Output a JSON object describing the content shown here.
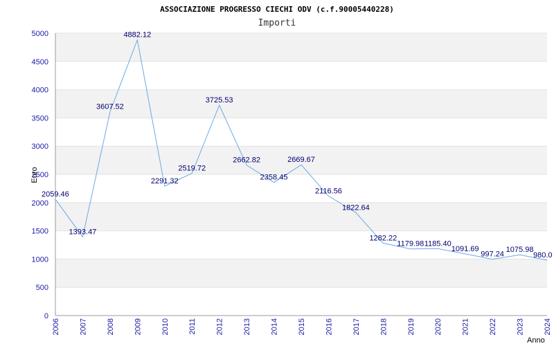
{
  "chart_data": {
    "type": "line",
    "title": "ASSOCIAZIONE PROGRESSO CIECHI ODV (c.f.90005440228)",
    "subtitle": "Importi",
    "xlabel": "Anno",
    "ylabel": "Euro",
    "x": [
      "2006",
      "2007",
      "2008",
      "2009",
      "2010",
      "2011",
      "2012",
      "2013",
      "2014",
      "2015",
      "2016",
      "2017",
      "2018",
      "2019",
      "2020",
      "2021",
      "2022",
      "2023",
      "2024"
    ],
    "series": [
      {
        "values": [
          2059.46,
          1393.47,
          3607.52,
          4882.12,
          2291.32,
          2519.72,
          3725.53,
          2662.82,
          2358.45,
          2669.67,
          2116.56,
          1822.64,
          1282.22,
          1179.98,
          1185.4,
          1091.69,
          997.24,
          1075.98,
          980.0
        ],
        "labels": [
          "2059.46",
          "1393.47",
          "3607.52",
          "4882.12",
          "2291.32",
          "2519.72",
          "3725.53",
          "2662.82",
          "2358.45",
          "2669.67",
          "2116.56",
          "1822.64",
          "1282.22",
          "1179.98",
          "1185.40",
          "1091.69",
          "997.24",
          "1075.98",
          "980.0"
        ]
      }
    ],
    "ylim": [
      0,
      5000
    ],
    "yticks": [
      "0",
      "500",
      "1000",
      "1500",
      "2000",
      "2500",
      "3000",
      "3500",
      "4000",
      "4500",
      "5000"
    ],
    "grid": "horizontal alternating bands",
    "colors": {
      "line": "#6aa9e6",
      "band": "#f2f2f2",
      "tick_text": "#1a1aa6",
      "label_text": "#00006e"
    }
  }
}
